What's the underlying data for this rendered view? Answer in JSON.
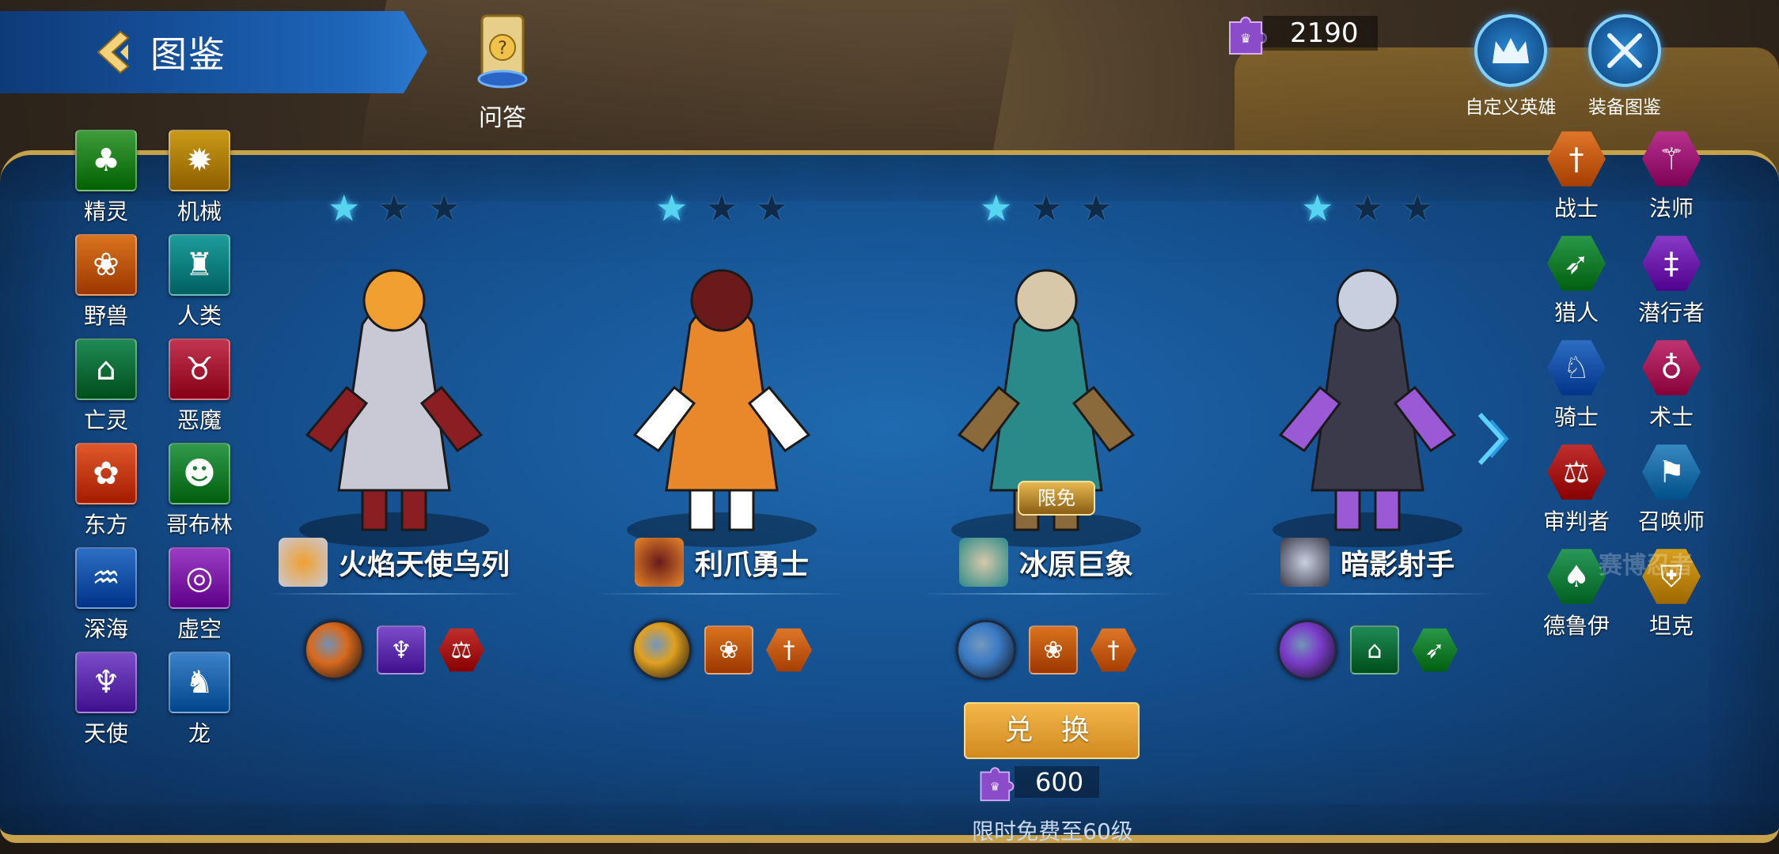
{
  "header": {
    "title": "图鉴",
    "qa_label": "问答"
  },
  "currency": {
    "amount": "2190"
  },
  "top_buttons": [
    {
      "label": "自定义英雄",
      "icon": "crown-icon"
    },
    {
      "label": "装备图鉴",
      "icon": "crossed-swords-icon"
    }
  ],
  "race_filters": [
    {
      "label": "精灵",
      "color": "#3e9d3a",
      "icon": "tree-icon"
    },
    {
      "label": "机械",
      "color": "#c99a16",
      "icon": "gear-icon"
    },
    {
      "label": "野兽",
      "color": "#d9731e",
      "icon": "paw-icon"
    },
    {
      "label": "人类",
      "color": "#1e9c9c",
      "icon": "helmet-icon"
    },
    {
      "label": "亡灵",
      "color": "#1f8a56",
      "icon": "crypt-icon"
    },
    {
      "label": "恶魔",
      "color": "#c23550",
      "icon": "demon-horns-icon"
    },
    {
      "label": "东方",
      "color": "#e0582a",
      "icon": "lotus-icon"
    },
    {
      "label": "哥布林",
      "color": "#2f9a4a",
      "icon": "goblin-icon"
    },
    {
      "label": "深海",
      "color": "#2a6fc4",
      "icon": "kraken-icon"
    },
    {
      "label": "虚空",
      "color": "#9a3cc4",
      "icon": "vortex-icon"
    },
    {
      "label": "天使",
      "color": "#7a4cc9",
      "icon": "angel-wings-icon"
    },
    {
      "label": "龙",
      "color": "#3a82c9",
      "icon": "dragon-icon"
    }
  ],
  "class_filters": [
    {
      "label": "战士",
      "color": "#e0782a",
      "icon": "sword-icon"
    },
    {
      "label": "法师",
      "color": "#b8338f",
      "icon": "staff-icon"
    },
    {
      "label": "猎人",
      "color": "#2a9a4a",
      "icon": "arrow-icon"
    },
    {
      "label": "潜行者",
      "color": "#8a3cc9",
      "icon": "dagger-icon"
    },
    {
      "label": "骑士",
      "color": "#2f6fc4",
      "icon": "horse-icon"
    },
    {
      "label": "术士",
      "color": "#c23573",
      "icon": "potion-icon"
    },
    {
      "label": "审判者",
      "color": "#c2302e",
      "icon": "judgement-icon"
    },
    {
      "label": "召唤师",
      "color": "#3a8ac4",
      "icon": "summon-icon"
    },
    {
      "label": "德鲁伊",
      "color": "#2a9a5a",
      "icon": "druid-icon"
    },
    {
      "label": "坦克",
      "color": "#d9a21e",
      "icon": "shield-icon"
    }
  ],
  "heroes": [
    {
      "name": "火焰天使乌列",
      "stars": 1,
      "skill_color": "#d96a1e",
      "traits": [
        {
          "color": "#7a4cc9",
          "icon": "angel-wings-icon",
          "hex": false
        },
        {
          "color": "#c2302e",
          "icon": "judgement-icon",
          "hex": true
        }
      ]
    },
    {
      "name": "利爪勇士",
      "stars": 1,
      "skill_color": "#e0a020",
      "traits": [
        {
          "color": "#d9731e",
          "icon": "paw-icon",
          "hex": false
        },
        {
          "color": "#e0782a",
          "icon": "sword-icon",
          "hex": true
        }
      ]
    },
    {
      "name": "冰原巨象",
      "stars": 1,
      "skill_color": "#3a7ac4",
      "traits": [
        {
          "color": "#d9731e",
          "icon": "paw-icon",
          "hex": false
        },
        {
          "color": "#e0782a",
          "icon": "sword-icon",
          "hex": true
        }
      ]
    },
    {
      "name": "暗影射手",
      "stars": 1,
      "skill_color": "#7a3cc9",
      "traits": [
        {
          "color": "#1f8a56",
          "icon": "crypt-icon",
          "hex": false
        },
        {
          "color": "#2a9a4a",
          "icon": "arrow-icon",
          "hex": true
        }
      ]
    }
  ],
  "badge": {
    "label": "限免"
  },
  "exchange": {
    "label": "兑 换",
    "cost": "600",
    "note": "限时免费至60级"
  },
  "offscreen_hero": {
    "partial_name": "赛博忍者"
  }
}
